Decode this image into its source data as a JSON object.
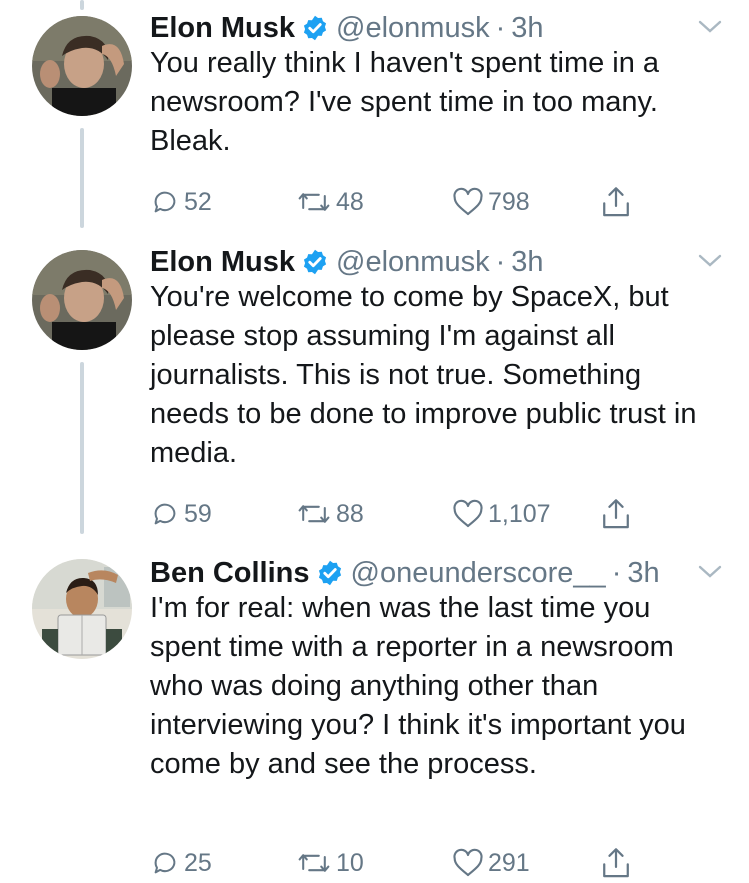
{
  "tweets": [
    {
      "name": "Elon Musk",
      "handle": "@elonmusk",
      "separator": "·",
      "time": "3h",
      "text": "You really think I haven't spent time in a newsroom? I've spent time in too many. Bleak.",
      "replies": "52",
      "retweets": "48",
      "likes": "798"
    },
    {
      "name": "Elon Musk",
      "handle": "@elonmusk",
      "separator": "·",
      "time": "3h",
      "text": "You're welcome to come by SpaceX, but please stop assuming I'm against all journalists. This is not true. Something needs to be done to improve public trust in media.",
      "replies": "59",
      "retweets": "88",
      "likes": "1,107"
    },
    {
      "name": "Ben Collins",
      "handle": "@oneunderscore__",
      "separator": "·",
      "time": "3h",
      "text": "I'm for real: when was the last time you spent time with a reporter in a newsroom who was doing anything other than interviewing you? I think it's important you come by and see the process.",
      "replies": "25",
      "retweets": "10",
      "likes": "291"
    }
  ],
  "colors": {
    "verified": "#1da1f2",
    "muted": "#657786",
    "thread_line": "#ccd6dd"
  },
  "icons": [
    "reply-icon",
    "retweet-icon",
    "like-icon",
    "share-icon",
    "verified-icon",
    "caret-down-icon"
  ]
}
